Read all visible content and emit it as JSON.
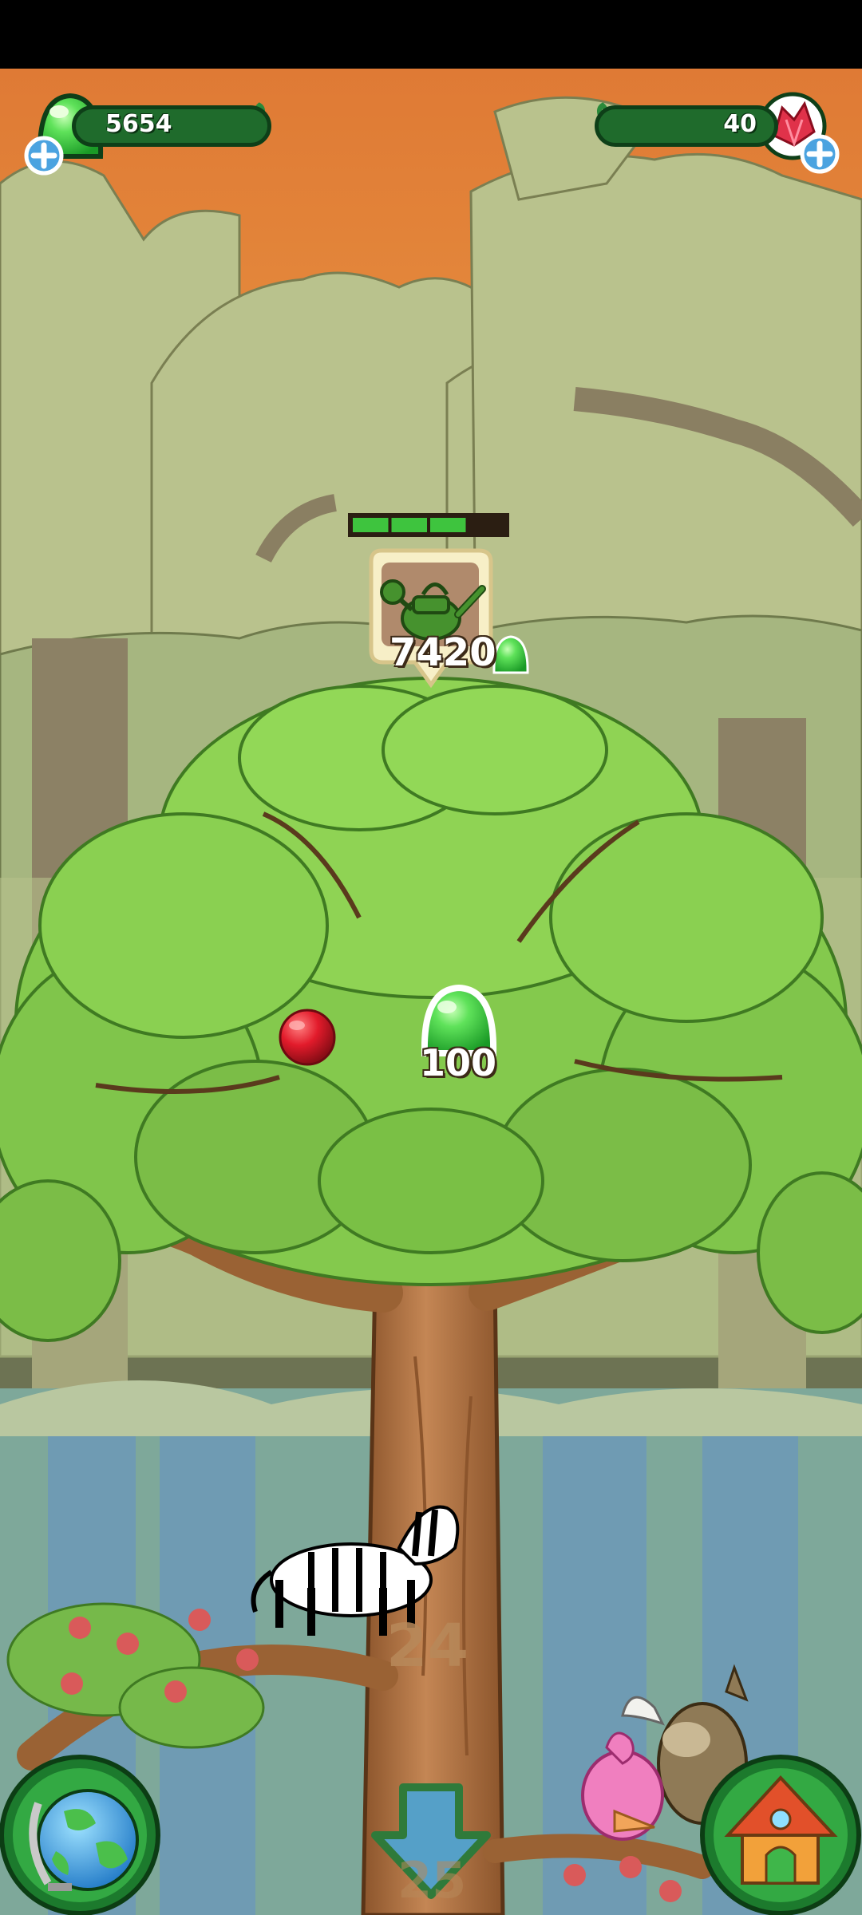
{
  "hud": {
    "drops": {
      "value": "5654",
      "icon": "green-drop-icon",
      "add_icon": "plus-icon"
    },
    "gems": {
      "value": "40",
      "icon": "red-gem-icon",
      "add_icon": "plus-icon"
    }
  },
  "upgrade": {
    "icon": "watering-can-icon",
    "cost": "7420",
    "currency_icon": "green-drop-icon",
    "progress_segments_filled": 3,
    "progress_segments_total": 4
  },
  "tree": {
    "drop_bubble_value": "100",
    "fruit_icon": "red-apple-icon",
    "level_current": "24",
    "level_next": "25"
  },
  "buttons": {
    "world": "globe-icon",
    "scroll_down": "down-arrow-icon",
    "home": "house-icon"
  },
  "colors": {
    "sky": "#e68a3f",
    "leaf": "#7cc44a",
    "trunk": "#b07344",
    "hud_green": "#1f6b2c",
    "drop_green": "#4bd14b",
    "gem_red": "#e0324a"
  }
}
